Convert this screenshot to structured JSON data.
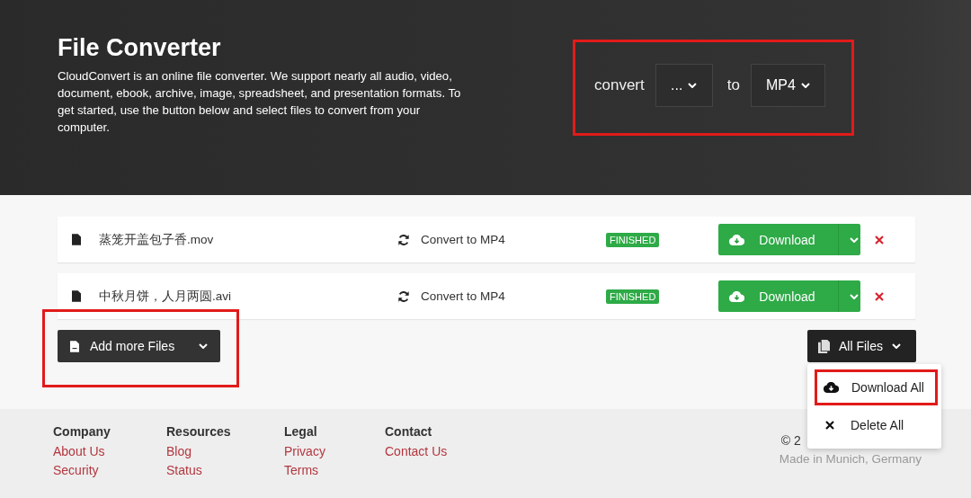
{
  "header": {
    "title": "File Converter",
    "description": "CloudConvert is an online file converter. We support nearly all audio, video, document, ebook, archive, image, spreadsheet, and presentation formats. To get started, use the button below and select files to convert from your computer.",
    "converter": {
      "highlighted": true,
      "label": "convert",
      "from": "...",
      "joiner": "to",
      "to": "MP4"
    }
  },
  "files": [
    {
      "name": "蒸笼开盖包子香.mov",
      "action": "Convert to MP4",
      "status": "FINISHED",
      "button": "Download"
    },
    {
      "name": "中秋月饼，人月两圆.avi",
      "action": "Convert to MP4",
      "status": "FINISHED",
      "button": "Download"
    }
  ],
  "add_button": {
    "label": "Add more Files",
    "highlighted": true
  },
  "all_files": {
    "label": "All Files",
    "expanded": true,
    "menu": [
      {
        "kind": "download",
        "label": "Download All",
        "highlighted": true
      },
      {
        "kind": "delete",
        "label": "Delete All",
        "highlighted": false
      }
    ]
  },
  "footer": {
    "columns": [
      {
        "heading": "Company",
        "links": [
          "About Us",
          "Security"
        ]
      },
      {
        "heading": "Resources",
        "links": [
          "Blog",
          "Status"
        ]
      },
      {
        "heading": "Legal",
        "links": [
          "Privacy",
          "Terms"
        ]
      },
      {
        "heading": "Contact",
        "links": [
          "Contact Us"
        ]
      }
    ],
    "copyright": "© 2",
    "location": "Made in Munich, Germany"
  }
}
